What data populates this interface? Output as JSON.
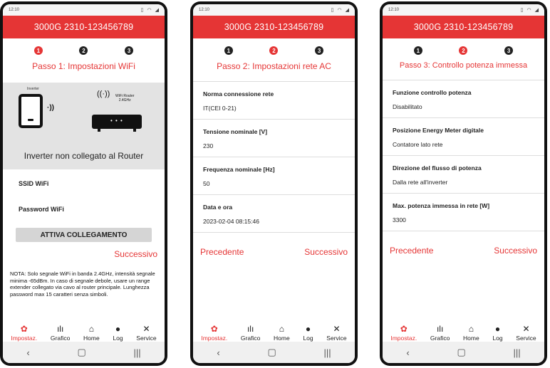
{
  "screens": [
    {
      "time": "12:10",
      "status_icons": [
        "vibrate-icon",
        "wifi-icon",
        "signal-icon"
      ],
      "title": "3000G 2310-123456789",
      "steps": [
        "1",
        "2",
        "3"
      ],
      "active_step": 1,
      "step_title": "Passo 1: Impostazioni WiFi",
      "diagram": {
        "inverter_label": "Inverter",
        "router_label_line1": "WiFi Router",
        "router_label_line2": "2.4GHz",
        "caption": "Inverter non collegato al Router"
      },
      "fields": {
        "ssid_label": "SSID WiFi",
        "password_label": "Password WiFi"
      },
      "activate_button": "ATTIVA COLLEGAMENTO",
      "next_label": "Successivo",
      "note": "NOTA: Solo segnale WiFi in banda 2.4GHz, intensità segnale minima -65dBm. In caso di segnale debole, usare un range extender collegato via cavo al router principale. Lunghezza password max 15 caratteri senza simboli."
    },
    {
      "time": "12:10",
      "title": "3000G 2310-123456789",
      "steps": [
        "1",
        "2",
        "3"
      ],
      "active_step": 2,
      "step_title": "Passo 2: Impostazioni rete AC",
      "items": [
        {
          "label": "Norma connessione rete",
          "value": "IT(CEI 0-21)"
        },
        {
          "label": "Tensione nominale [V]",
          "value": "230"
        },
        {
          "label": "Frequenza nominale [Hz]",
          "value": "50"
        },
        {
          "label": "Data e ora",
          "value": "2023-02-04 08:15:46"
        }
      ],
      "prev_label": "Precedente",
      "next_label": "Successivo"
    },
    {
      "time": "12:10",
      "title": "3000G 2310-123456789",
      "steps": [
        "1",
        "2",
        "3"
      ],
      "active_step": 3,
      "step_title": "Passo 3: Controllo potenza immessa",
      "items": [
        {
          "label": "Funzione controllo potenza",
          "value": "Disabilitato"
        },
        {
          "label": "Posizione Energy Meter digitale",
          "value": "Contatore lato rete"
        },
        {
          "label": "Direzione del flusso di potenza",
          "value": "Dalla rete all'inverter"
        },
        {
          "label": "Max. potenza immessa in rete [W]",
          "value": "3300"
        }
      ],
      "prev_label": "Precedente",
      "next_label": "Successivo"
    }
  ],
  "tabbar": [
    {
      "label": "Impostaz.",
      "icon": "gear-icon",
      "glyph": "✿"
    },
    {
      "label": "Grafico",
      "icon": "chart-icon",
      "glyph": "ılı"
    },
    {
      "label": "Home",
      "icon": "home-icon",
      "glyph": "⌂"
    },
    {
      "label": "Log",
      "icon": "info-icon",
      "glyph": "●"
    },
    {
      "label": "Service",
      "icon": "tools-icon",
      "glyph": "✕"
    }
  ],
  "sysnav": [
    {
      "icon": "back-icon",
      "glyph": "‹"
    },
    {
      "icon": "home-circle-icon",
      "glyph": "▢"
    },
    {
      "icon": "recents-icon",
      "glyph": "|||"
    }
  ],
  "colors": {
    "accent": "#e53535",
    "panel": "#e3e3e3",
    "button": "#d5d5d5"
  }
}
